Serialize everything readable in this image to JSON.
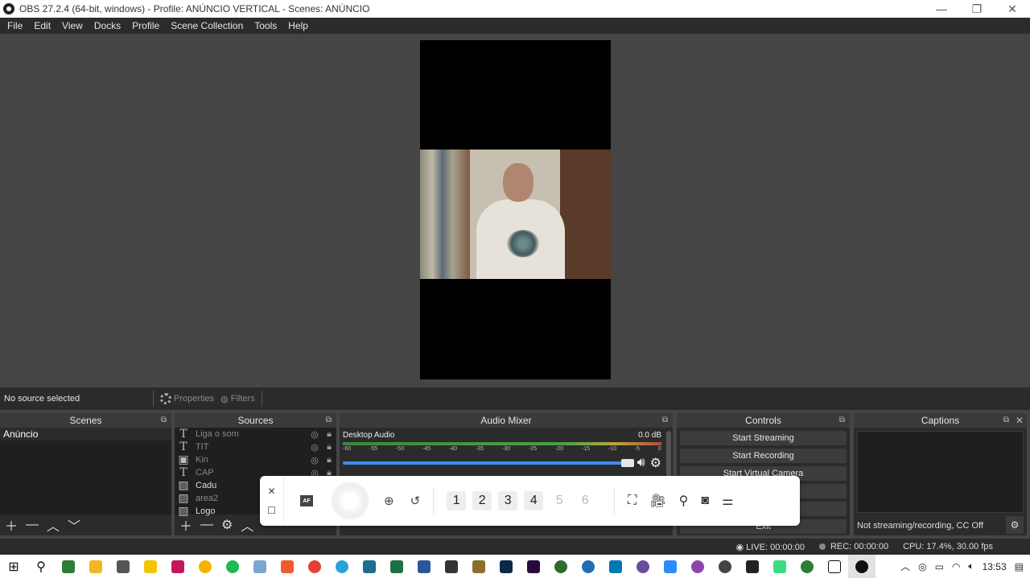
{
  "window": {
    "title": "OBS 27.2.4 (64-bit, windows) - Profile: ANÚNCIO VERTICAL - Scenes: ANÚNCIO",
    "minimize": "—",
    "restore": "❐",
    "close": "✕"
  },
  "menu": [
    "File",
    "Edit",
    "View",
    "Docks",
    "Profile",
    "Scene Collection",
    "Tools",
    "Help"
  ],
  "source_toolbar": {
    "status": "No source selected",
    "properties": "Properties",
    "filters": "Filters"
  },
  "scenes": {
    "title": "Scenes",
    "items": [
      "Anúncio"
    ]
  },
  "sources": {
    "title": "Sources",
    "items": [
      {
        "name": "Liga o som",
        "icon": "text-icon"
      },
      {
        "name": "TIT",
        "icon": "text-icon"
      },
      {
        "name": "Kin",
        "icon": "video-capture-icon"
      },
      {
        "name": "CAP",
        "icon": "text-icon"
      },
      {
        "name": "Cadu",
        "icon": "image-icon"
      },
      {
        "name": "area2",
        "icon": "image-icon"
      },
      {
        "name": "Logo",
        "icon": "image-icon"
      }
    ]
  },
  "mixer": {
    "title": "Audio Mixer",
    "channel_name": "Desktop Audio",
    "channel_db": "0.0 dB",
    "ticks": [
      "-60",
      "-55",
      "-50",
      "-45",
      "-40",
      "-35",
      "-30",
      "-25",
      "-20",
      "-15",
      "-10",
      "-5",
      "0"
    ],
    "volume_level": 0.97
  },
  "controls": {
    "title": "Controls",
    "buttons": [
      "Start Streaming",
      "Start Recording",
      "Start Virtual Camera",
      "",
      "",
      "Exit"
    ]
  },
  "captions": {
    "title": "Captions",
    "status": "Not streaming/recording, CC Off"
  },
  "statusbar": {
    "live": "LIVE: 00:00:00",
    "rec": "REC: 00:00:00",
    "cpu": "CPU: 17.4%, 30.00 fps"
  },
  "float_toolbar": {
    "af_label": "AF",
    "presets": [
      "1",
      "2",
      "3",
      "4",
      "5",
      "6"
    ]
  },
  "taskbar": {
    "time": "13:53"
  }
}
